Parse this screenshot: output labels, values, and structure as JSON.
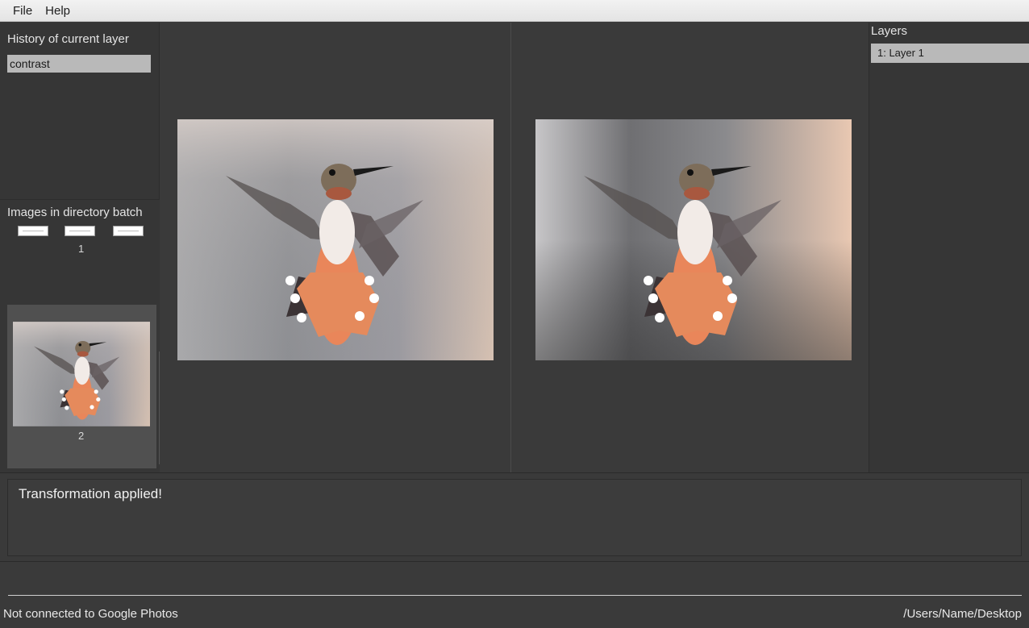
{
  "menu": {
    "file": "File",
    "help": "Help"
  },
  "history": {
    "title": "History of current layer",
    "items": [
      "contrast"
    ]
  },
  "batch": {
    "title": "Images in directory batch",
    "group1_label": "1",
    "group2_label": "2"
  },
  "layers": {
    "title": "Layers",
    "items": [
      "1: Layer 1"
    ]
  },
  "console": {
    "message": "Transformation applied!"
  },
  "status": {
    "connection": "Not connected to Google Photos",
    "path": "/Users/Name/Desktop"
  },
  "colors": {
    "panel": "#363636",
    "selected_item": "#b9b9b9",
    "menubar": "#ececec"
  }
}
